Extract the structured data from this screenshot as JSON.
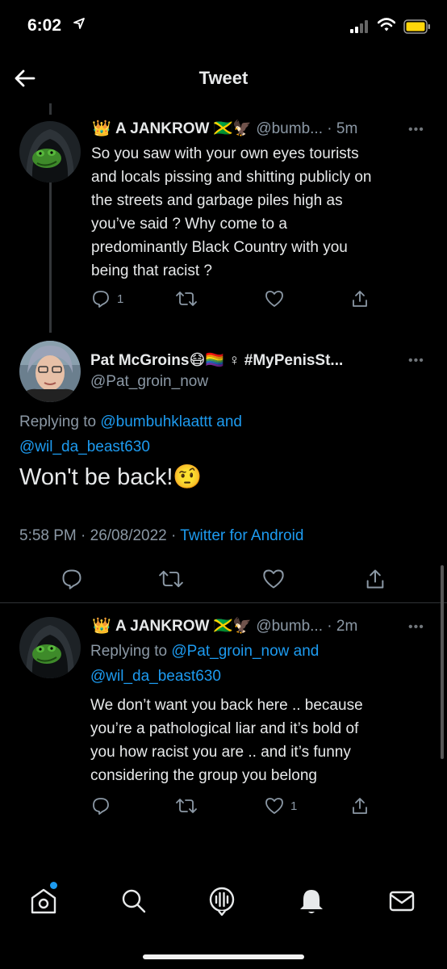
{
  "status_bar": {
    "time": "6:02"
  },
  "header": {
    "title": "Tweet"
  },
  "tweet1": {
    "name": "A JANKROW",
    "handle": "@bumb...",
    "time": "· 5m",
    "text_lines": [
      "So you saw with your own eyes tourists",
      "and locals pissing and shitting publicly on",
      "the streets and garbage piles high as",
      "you’ve said ? Why come to a",
      "predominantly Black Country with you",
      "being that racist ?"
    ],
    "reply_count": "1"
  },
  "main_tweet": {
    "name": "Pat McGroins",
    "name_suffix": "♀ #MyPenisSt...",
    "handle": "@Pat_groin_now",
    "replying_prefix": "Replying to",
    "reply_to_1": "@bumbuhklaattt",
    "reply_and": "and",
    "reply_to_2": "@wil_da_beast630",
    "text": "Won't be back!",
    "timestamp": "5:58 PM · 26/08/2022 ·",
    "source": "Twitter for Android"
  },
  "tweet3": {
    "name": "A JANKROW",
    "handle": "@bumb...",
    "time": "· 2m",
    "replying_prefix": "Replying to",
    "reply_to_1": "@Pat_groin_now",
    "reply_and": "and",
    "reply_to_2": "@wil_da_beast630",
    "text_lines": [
      "We don’t want you back here .. because",
      "you’re a pathological liar and it’s bold of",
      "you how racist you are .. and it’s funny",
      "considering the group you belong"
    ],
    "like_count": "1"
  },
  "colors": {
    "accent": "#1d9bf0",
    "text": "#e7e9ea",
    "secondary": "#8b98a5",
    "background": "#000000"
  },
  "icons": {
    "tab_home": "home-icon",
    "tab_search": "search-icon",
    "tab_spaces": "spaces-icon",
    "tab_notifications": "bell-icon",
    "tab_messages": "mail-icon"
  }
}
